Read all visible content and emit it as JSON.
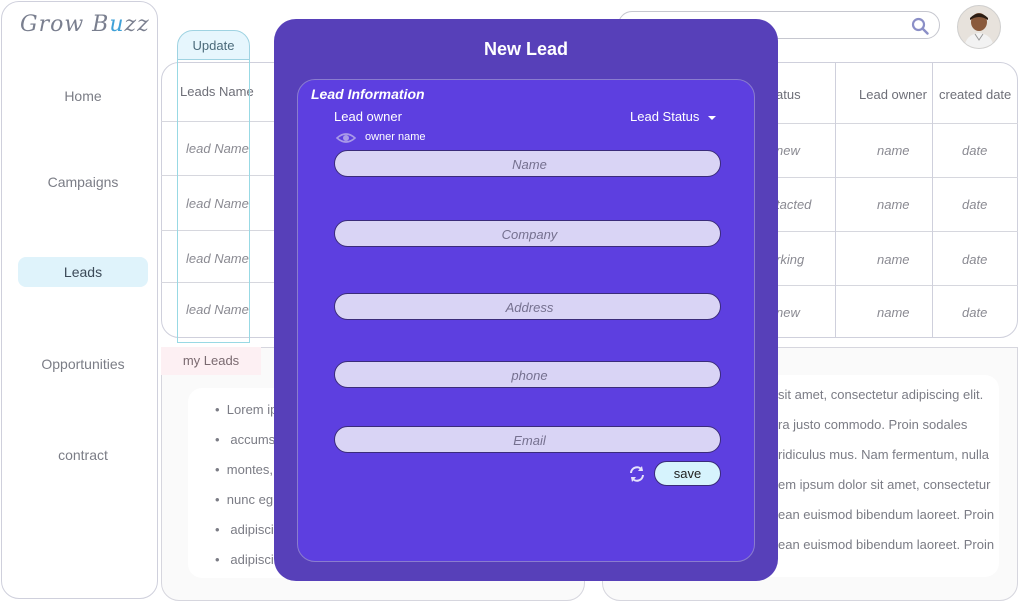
{
  "app": {
    "logo_part1": "Grow B",
    "logo_accent": "u",
    "logo_part2": "zz"
  },
  "sidebar": {
    "items": [
      {
        "label": "Home"
      },
      {
        "label": "Campaigns"
      },
      {
        "label": "Leads",
        "active": true
      },
      {
        "label": "Opportunities"
      },
      {
        "label": "contract"
      }
    ]
  },
  "search": {
    "placeholder": "Search"
  },
  "toolbar": {
    "update_label": "Update"
  },
  "table": {
    "headers": {
      "leads_name": "Leads Name",
      "status": "atus",
      "lead_owner": "Lead owner",
      "created_date": "created date"
    },
    "rows": [
      {
        "name": "lead Name",
        "status": "new",
        "owner": "name",
        "date": "date"
      },
      {
        "name": "lead Name",
        "status": "tacted",
        "owner": "name",
        "date": "date"
      },
      {
        "name": "lead Name",
        "status": "rking",
        "owner": "name",
        "date": "date"
      },
      {
        "name": "lead Name",
        "status": "new",
        "owner": "name",
        "date": "date"
      }
    ]
  },
  "my_leads": {
    "tab_label": "my Leads",
    "left_bullets": [
      "Lorem ip",
      "accums",
      "montes,",
      "nunc eg",
      "adipisci",
      "adipisci"
    ],
    "right_lines": [
      "sit amet, consectetur adipiscing elit.",
      "ra justo commodo. Proin sodales",
      "ridiculus mus. Nam fermentum, nulla",
      "em ipsum dolor sit amet, consectetur",
      "ean euismod bibendum laoreet. Proin",
      "ean euismod bibendum laoreet. Proin"
    ]
  },
  "modal": {
    "title": "New Lead",
    "section_title": "Lead Information",
    "lead_owner_label": "Lead owner",
    "lead_status_label": "Lead Status",
    "owner_name": "owner name",
    "fields": {
      "name": "Name",
      "company": "Company",
      "address": "Address",
      "phone": "phone",
      "email": "Email"
    },
    "save_label": "save"
  },
  "colors": {
    "modal_bg": "#5740b9",
    "card_bg": "#5d3fe0",
    "field_bg": "#d9d4f5",
    "save_bg": "#d6f3fd",
    "active_nav": "#dff3fb"
  }
}
